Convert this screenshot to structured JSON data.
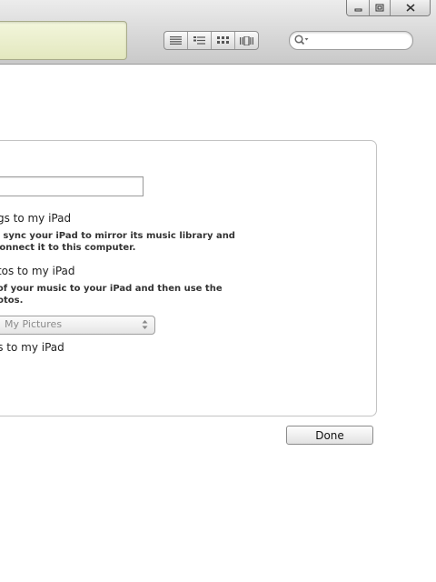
{
  "window": {
    "controls": [
      "minimize-icon",
      "maximize-icon",
      "close-icon"
    ]
  },
  "toolbar": {
    "view_buttons": [
      "list-view-icon",
      "album-list-view-icon",
      "grid-view-icon",
      "cover-flow-view-icon"
    ],
    "search_placeholder": ""
  },
  "panel": {
    "name_field_value": "",
    "options": [
      {
        "title": "ongs to my iPad",
        "description_lines": [
          "ly sync your iPad to mirror its music library and",
          " connect it to this computer."
        ]
      },
      {
        "title": "hotos to my iPad",
        "description_lines": [
          "l of your music to your iPad and then use the",
          "hotos."
        ],
        "select_value": "My Pictures"
      },
      {
        "title": "pps to my iPad"
      }
    ]
  },
  "footer": {
    "done_label": "Done"
  }
}
